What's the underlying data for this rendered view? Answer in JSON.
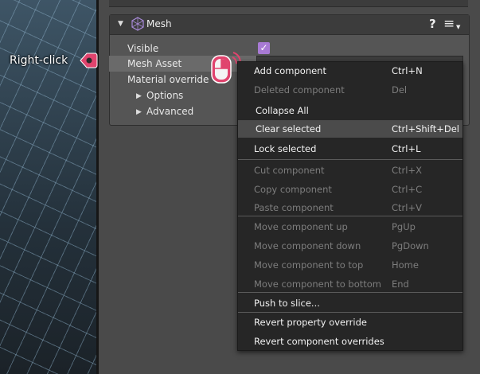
{
  "component": {
    "title": "Mesh",
    "help_glyph": "?",
    "menu_glyph": "≡",
    "collapse_glyph": "▼"
  },
  "properties": {
    "visible": "Visible",
    "mesh_asset": "Mesh Asset",
    "material_override": "Material override",
    "options": "Options",
    "advanced": "Advanced",
    "checkbox_glyph": "✓"
  },
  "callout": {
    "label": "Right-click"
  },
  "context_menu": {
    "items": [
      {
        "label": "Add component",
        "shortcut": "Ctrl+N",
        "enabled": true
      },
      {
        "label": "Deleted component",
        "shortcut": "Del",
        "enabled": false
      },
      {
        "label": "Collapse All",
        "shortcut": "",
        "enabled": true
      },
      {
        "label": "Clear selected",
        "shortcut": "Ctrl+Shift+Del",
        "enabled": true,
        "highlighted": true
      },
      {
        "label": "Lock selected",
        "shortcut": "Ctrl+L",
        "enabled": true
      },
      {
        "label": "Cut component",
        "shortcut": "Ctrl+X",
        "enabled": false
      },
      {
        "label": "Copy component",
        "shortcut": "Ctrl+C",
        "enabled": false
      },
      {
        "label": "Paste component",
        "shortcut": "Ctrl+V",
        "enabled": false
      },
      {
        "label": "Move component up",
        "shortcut": "PgUp",
        "enabled": false
      },
      {
        "label": "Move component down",
        "shortcut": "PgDown",
        "enabled": false
      },
      {
        "label": "Move component to top",
        "shortcut": "Home",
        "enabled": false
      },
      {
        "label": "Move component to bottom",
        "shortcut": "End",
        "enabled": false
      },
      {
        "label": "Push to slice...",
        "shortcut": "",
        "enabled": true
      },
      {
        "label": "Revert property override",
        "shortcut": "",
        "enabled": true
      },
      {
        "label": "Revert component overrides",
        "shortcut": "",
        "enabled": true
      }
    ]
  },
  "colors": {
    "accent_purple": "#a87ad4",
    "callout_pink": "#e0446e",
    "menu_bg": "#262626",
    "menu_highlight": "#4b4b4b"
  }
}
